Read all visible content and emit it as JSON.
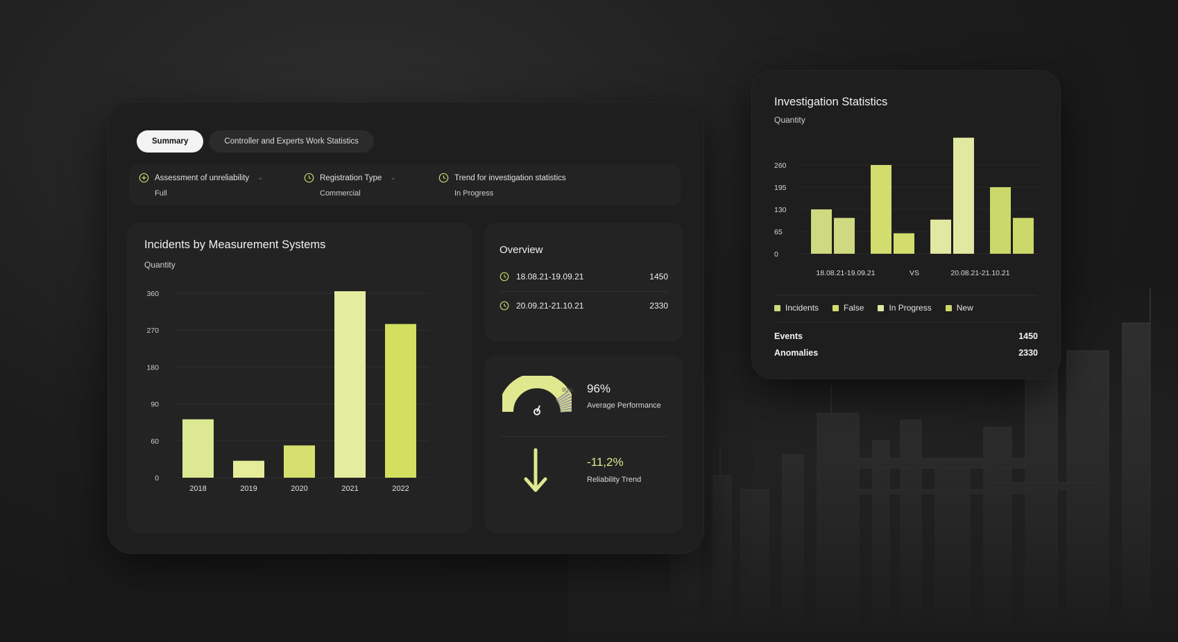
{
  "tabs": [
    {
      "label": "Summary",
      "active": true
    },
    {
      "label": "Controller and Experts Work Statistics",
      "active": false
    }
  ],
  "filters": [
    {
      "label": "Assessment of unreliability",
      "value": "Full",
      "icon": "plus-circle-icon",
      "dropdown": true
    },
    {
      "label": "Registration Type",
      "value": "Commercial",
      "icon": "clock-icon",
      "dropdown": true
    },
    {
      "label": "Trend for investigation statistics",
      "value": "In Progress",
      "icon": "clock-icon",
      "dropdown": false
    }
  ],
  "incidents": {
    "title": "Incidents by Measurement Systems",
    "subtitle": "Quantity"
  },
  "overview": {
    "title": "Overview",
    "rows": [
      {
        "date": "18.08.21-19.09.21",
        "value": "1450"
      },
      {
        "date": "20.09.21-21.10.21",
        "value": "2330"
      }
    ]
  },
  "performance": {
    "value": "96%",
    "label": "Average Performance",
    "gauge_fraction": 0.96,
    "gauge_tick": "90%"
  },
  "reliability": {
    "value": "-11,2%",
    "label": "Reliability Trend"
  },
  "investigation": {
    "title": "Investigation Statistics",
    "subtitle": "Quantity",
    "vs_label": "VS",
    "period_labels": [
      "18.08.21-19.09.21",
      "20.08.21-21.10.21"
    ],
    "legend": [
      {
        "label": "Incidents",
        "color": "#cfd97f"
      },
      {
        "label": "False",
        "color": "#d3dd6e"
      },
      {
        "label": "In Progress",
        "color": "#e1e8a2"
      },
      {
        "label": "New",
        "color": "#cbd86a"
      }
    ],
    "stats": [
      {
        "label": "Events",
        "value": "1450"
      },
      {
        "label": "Anomalies",
        "value": "2330"
      }
    ]
  },
  "chart_data": [
    {
      "type": "bar",
      "title": "Incidents by Measurement Systems",
      "ylabel": "Quantity",
      "categories": [
        "2018",
        "2019",
        "2020",
        "2021",
        "2022"
      ],
      "values": [
        114,
        33,
        63,
        364,
        300
      ],
      "yticks": [
        "0",
        "60",
        "90",
        "180",
        "270",
        "360"
      ],
      "ylim": [
        0,
        360
      ],
      "grid": true,
      "colors": [
        "#dde893",
        "#e5ed9a",
        "#d6e070",
        "#e4ec9f",
        "#d3df5e"
      ]
    },
    {
      "type": "bar",
      "title": "Investigation Statistics",
      "ylabel": "Quantity",
      "categories": [
        "Incidents",
        "False",
        "In Progress",
        "New"
      ],
      "series": [
        {
          "name": "18.08.21-19.09.21",
          "values": [
            130,
            260,
            100,
            195
          ]
        },
        {
          "name": "20.08.21-21.10.21",
          "values": [
            105,
            60,
            340,
            105
          ]
        }
      ],
      "yticks": [
        0,
        65,
        130,
        195,
        260
      ],
      "ylim": [
        0,
        260
      ],
      "grid": true,
      "legend": "bottom",
      "colors": [
        "#cfd97f",
        "#d3dd6e",
        "#e1e8a2",
        "#cbd86a"
      ]
    }
  ]
}
